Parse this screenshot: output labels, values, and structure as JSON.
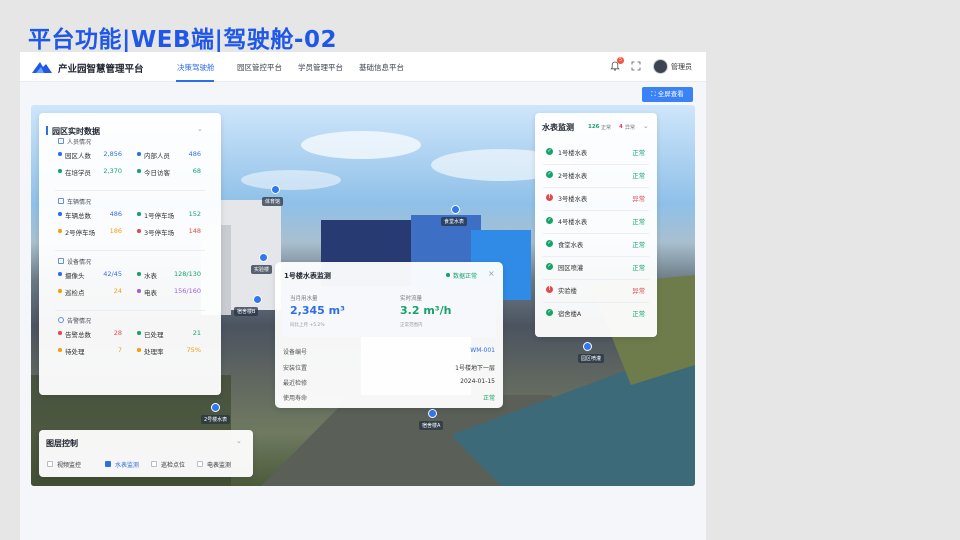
{
  "slide_title": "平台功能|WEB端|驾驶舱-02",
  "header": {
    "brand": "产业园智慧管理平台",
    "nav": [
      "决策驾驶舱",
      "园区管控平台",
      "学员管理平台",
      "基础信息平台"
    ],
    "notification_count": "5",
    "user": "管理员"
  },
  "fullscreen_label": "⛶ 全屏查看",
  "realtime": {
    "title": "园区实时数据",
    "sections": [
      {
        "name": "人员情况",
        "items": [
          {
            "label": "园区人数",
            "value": "2,856",
            "color": "#2f6fe4"
          },
          {
            "label": "内部人员",
            "value": "486",
            "color": "#2f6fe4"
          },
          {
            "label": "在培学员",
            "value": "2,370",
            "color": "#16a36a"
          },
          {
            "label": "今日访客",
            "value": "68",
            "color": "#16a36a"
          }
        ]
      },
      {
        "name": "车辆情况",
        "items": [
          {
            "label": "车辆总数",
            "value": "486",
            "color": "#2f6fe4"
          },
          {
            "label": "1号停车场",
            "value": "152",
            "color": "#16a36a"
          },
          {
            "label": "2号停车场",
            "value": "186",
            "color": "#f59e0b"
          },
          {
            "label": "3号停车场",
            "value": "148",
            "color": "#e5484d"
          }
        ]
      },
      {
        "name": "设备情况",
        "items": [
          {
            "label": "摄像头",
            "value": "42/45",
            "color": "#2f6fe4"
          },
          {
            "label": "水表",
            "value": "128/130",
            "color": "#16a36a"
          },
          {
            "label": "巡检点",
            "value": "24",
            "color": "#f59e0b"
          },
          {
            "label": "电表",
            "value": "156/160",
            "color": "#9b5de5"
          }
        ]
      },
      {
        "name": "告警情况",
        "items": [
          {
            "label": "告警总数",
            "value": "28",
            "color": "#e5484d"
          },
          {
            "label": "已处理",
            "value": "21",
            "color": "#16a36a"
          },
          {
            "label": "待处理",
            "value": "7",
            "color": "#f59e0b"
          },
          {
            "label": "处理率",
            "value": "75%",
            "color": "#f59e0b"
          }
        ]
      }
    ]
  },
  "water": {
    "title": "水表监测",
    "normal_count": "126",
    "normal_label": "正常",
    "abnormal_count": "4",
    "abnormal_label": "异常",
    "items": [
      {
        "name": "1号楼水表",
        "status": "正常",
        "ok": true
      },
      {
        "name": "2号楼水表",
        "status": "正常",
        "ok": true
      },
      {
        "name": "3号楼水表",
        "status": "异常",
        "ok": false
      },
      {
        "name": "4号楼水表",
        "status": "正常",
        "ok": true
      },
      {
        "name": "食堂水表",
        "status": "正常",
        "ok": true
      },
      {
        "name": "园区喷灌",
        "status": "正常",
        "ok": true
      },
      {
        "name": "实验楼",
        "status": "异常",
        "ok": false
      },
      {
        "name": "宿舍楼A",
        "status": "正常",
        "ok": true
      }
    ]
  },
  "popup": {
    "title": "1号楼水表监测",
    "status": "数据正常",
    "metric1_label": "当月用水量",
    "metric1_value": "2,345 m³",
    "metric1_sub": "同比上月 +5.2%",
    "metric2_label": "实时流量",
    "metric2_value": "3.2 m³/h",
    "metric2_sub": "正常范围内",
    "rows": [
      {
        "k": "设备编号",
        "v": "WM-001"
      },
      {
        "k": "安装位置",
        "v": "1号楼地下一层"
      },
      {
        "k": "最近检修",
        "v": "2024-01-15"
      },
      {
        "k": "使用寿命",
        "v": "正常"
      }
    ]
  },
  "layers": {
    "title": "图层控制",
    "items": [
      {
        "label": "视频监控",
        "checked": false
      },
      {
        "label": "水表监测",
        "checked": true
      },
      {
        "label": "巡检点位",
        "checked": false
      },
      {
        "label": "电表监测",
        "checked": false
      }
    ]
  },
  "map_labels": [
    "体育馆",
    "食堂水表",
    "实验楼",
    "宿舍楼B",
    "2号楼水表",
    "园区喷灌",
    "宿舍楼A"
  ],
  "colors": {
    "accent": "#2f6fe4",
    "ok": "#16a36a",
    "bad": "#e5484d"
  }
}
